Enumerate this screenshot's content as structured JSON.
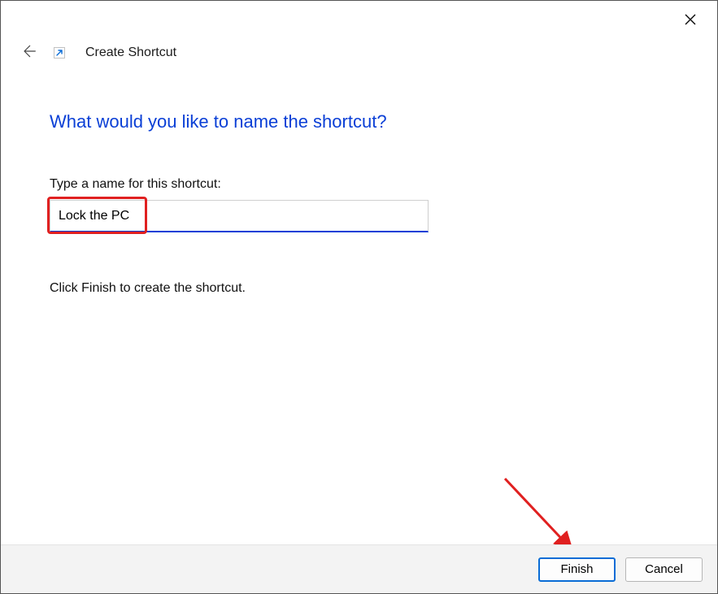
{
  "titlebar": {
    "close_aria": "Close"
  },
  "header": {
    "back_aria": "Back",
    "wizard_title": "Create Shortcut"
  },
  "content": {
    "heading": "What would you like to name the shortcut?",
    "label": "Type a name for this shortcut:",
    "input_value": "Lock the PC",
    "instruction": "Click Finish to create the shortcut."
  },
  "footer": {
    "finish_label": "Finish",
    "cancel_label": "Cancel"
  }
}
